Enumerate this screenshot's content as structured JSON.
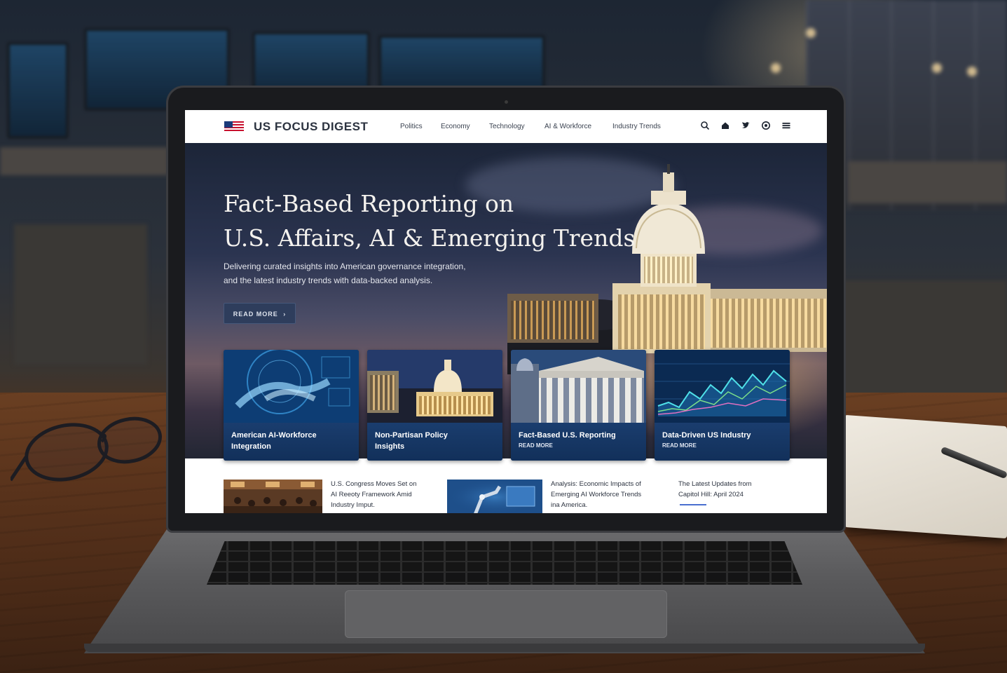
{
  "site": {
    "brand": "US FOCUS DIGEST",
    "nav": [
      "Politics",
      "Economy",
      "Technology",
      "AI & Workforce",
      "Industry Trends"
    ],
    "nav_icons": [
      "search-icon",
      "home-icon",
      "twitter-icon",
      "instagram-icon",
      "menu-icon"
    ]
  },
  "hero": {
    "title_line1": "Fact-Based Reporting on",
    "title_line2": "U.S. Affairs, AI & Emerging Trends",
    "subtitle_line1": "Delivering curated insights into American governance integration,",
    "subtitle_line2": "and the latest industry trends with data-backed analysis.",
    "button": "READ MORE",
    "button_arrow": "›"
  },
  "cards": [
    {
      "title_line1": "American AI-Workforce",
      "title_line2": "Integration",
      "more": ""
    },
    {
      "title_line1": "Non-Partisan Policy",
      "title_line2": "Insights",
      "more": ""
    },
    {
      "title_line1": "Fact-Based U.S. Reporting",
      "title_line2": "",
      "more": "READ MORE"
    },
    {
      "title_line1": "Data-Driven US Industry",
      "title_line2": "",
      "more": "READ MORE"
    }
  ],
  "news": [
    {
      "line1": "U.S. Congress Moves Set on",
      "line2": "AI Reeoty Framework Amid",
      "line3": "Industry Imput."
    },
    {
      "line1": "Analysis: Economic Impacts of",
      "line2": "Emerging AI Workforce Trends",
      "line3": "ina America."
    },
    {
      "line1": "The Latest Updates from",
      "line2": "Capitol Hill: April 2024",
      "line3": ""
    }
  ],
  "colors": {
    "nav_bg": "#ffffff",
    "hero_dark": "#1c2538",
    "card_blue": "#13305a",
    "button": "#2e3d5c",
    "accent_link": "#4a6fd0"
  }
}
